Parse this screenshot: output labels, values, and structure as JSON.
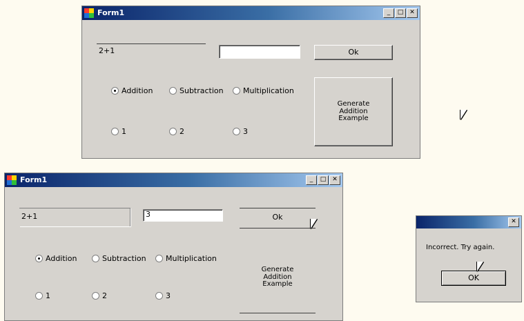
{
  "window1": {
    "title": "Form1",
    "display_value": "2+1",
    "input_value": "",
    "ok_label": "Ok",
    "radios": [
      "Addition",
      "Subtraction",
      "Multiplication",
      "1",
      "2",
      "3"
    ],
    "side_button_text": "Generate\nAddition\nExample",
    "selected_radio": "Addition"
  },
  "window2": {
    "title": "Form1",
    "display_value": "2+1",
    "input_value": "3",
    "ok_label": "Ok",
    "radios": [
      "Addition",
      "Subtraction",
      "Multiplication",
      "1",
      "2",
      "3"
    ],
    "side_button_text": "Generate\nAddition\nExample",
    "selected_radio": "Addition"
  },
  "dialog": {
    "title": "",
    "message": "Incorrect. Try again.",
    "ok_label": "OK"
  },
  "titlebar_icons": [
    "minimize-icon",
    "maximize-icon",
    "close-icon"
  ]
}
